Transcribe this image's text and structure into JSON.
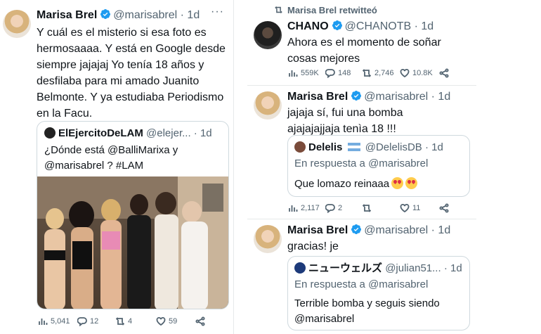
{
  "left_tweet": {
    "name": "Marisa Brel",
    "handle": "@marisabrel",
    "time": "· 1d",
    "text": "Y cuál es el misterio si esa foto es hermosaaaa. Y está en Google desde siempre jajajaj Yo tenía 18 años y desfilaba para mi amado Juanito Belmonte. Y ya estudiaba Periodismo en la Facu.",
    "quote": {
      "name": "ElEjercitoDeLAM",
      "handle": "@elejer...",
      "time": "· 1d",
      "text": "¿Dónde está @BalliMarixa y @marisabrel ? #LAM"
    },
    "stats": {
      "views": "5,041",
      "replies": "12",
      "retweets": "4",
      "likes": "59"
    }
  },
  "right": {
    "retweeted_label": "Marisa Brel retwitteó",
    "tweet1": {
      "name": "CHANO",
      "handle": "@CHANOTB",
      "time": "· 1d",
      "text": "Ahora es el momento de soñar cosas mejores",
      "stats": {
        "views": "559K",
        "replies": "148",
        "retweets": "2,746",
        "likes": "10.8K"
      }
    },
    "tweet2": {
      "name": "Marisa Brel",
      "handle": "@marisabrel",
      "time": "· 1d",
      "text": "jajaja sí, fui una bomba ajajajajjaja tenìa 18 !!!",
      "quote": {
        "name": "Delelis",
        "handle": "@DelelisDB",
        "time": "· 1d",
        "reply_to": "En respuesta a @marisabrel",
        "text": "Que lomazo reinaaa"
      },
      "stats": {
        "views": "2,117",
        "replies": "2",
        "retweets": "",
        "likes": "11"
      }
    },
    "tweet3": {
      "name": "Marisa Brel",
      "handle": "@marisabrel",
      "time": "· 1d",
      "text": "gracias! je",
      "quote": {
        "name": "ニューウェルズ",
        "handle": "@julian51...",
        "time": "· 1d",
        "reply_to": "En respuesta a @marisabrel",
        "text": "Terrible bomba y seguis siendo @marisabrel"
      }
    }
  },
  "colors": {
    "verified": "#1d9bf0",
    "text": "#0f1419",
    "muted": "#536471",
    "border": "#cfd9de"
  }
}
